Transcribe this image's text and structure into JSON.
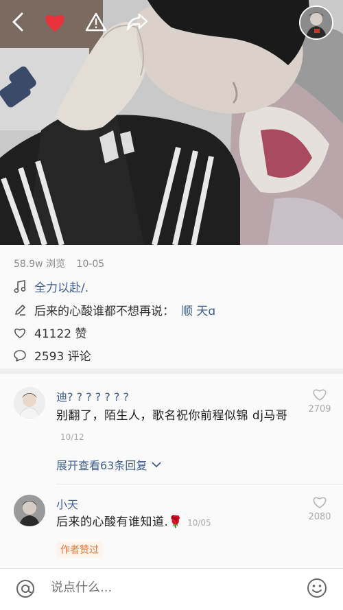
{
  "header": {
    "icons": [
      "back-arrow-icon",
      "heart-icon",
      "warning-icon",
      "share-icon",
      "author-avatar"
    ]
  },
  "stats": {
    "views": "58.9w 浏览",
    "date": "10-05"
  },
  "music": {
    "title": "全力以赴/."
  },
  "caption": {
    "text": "后来的心酸谁都不想再说：",
    "mention": "顺 天ɑ"
  },
  "likes": {
    "label": "41122 赞"
  },
  "comments_count": {
    "label": "2593 评论"
  },
  "comments": [
    {
      "name": "迪? ? ? ? ? ? ?",
      "text": "别翻了，陌生人，歌名祝你前程似锦  dj马哥",
      "date": "10/12",
      "likes": "2709",
      "expand": "展开查看63条回复"
    },
    {
      "name": "小天",
      "text": "后来的心酸有谁知道.🌹",
      "date": "10/05",
      "likes": "2080",
      "badge": "作者赞过"
    }
  ],
  "input": {
    "placeholder": "说点什么..."
  },
  "colors": {
    "link": "#3d5d8a",
    "heart": "#e8333c",
    "badge": "#e07a3a"
  }
}
